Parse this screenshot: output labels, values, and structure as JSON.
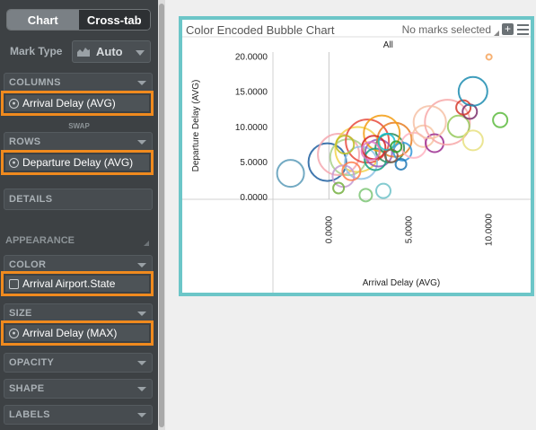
{
  "tabs": {
    "chart": "Chart",
    "crosstab": "Cross-tab"
  },
  "mark_type": {
    "label": "Mark Type",
    "value": "Auto"
  },
  "shelves": {
    "columns": {
      "label": "COLUMNS",
      "pill": "Arrival Delay (AVG)"
    },
    "swap": "SWAP",
    "rows": {
      "label": "ROWS",
      "pill": "Departure Delay (AVG)"
    },
    "details": {
      "label": "DETAILS"
    },
    "appearance": "APPEARANCE",
    "color": {
      "label": "COLOR",
      "pill": "Arrival Airport.State"
    },
    "size": {
      "label": "SIZE",
      "pill": "Arrival Delay (MAX)"
    },
    "opacity": {
      "label": "OPACITY"
    },
    "shape": {
      "label": "SHAPE"
    },
    "labels": {
      "label": "LABELS"
    }
  },
  "chart_header": {
    "title": "Color Encoded Bubble Chart",
    "status": "No marks selected"
  },
  "chart_data": {
    "type": "scatter",
    "title": "Color Encoded Bubble Chart",
    "column_header": "All",
    "xlabel": "Arrival Delay (AVG)",
    "ylabel": "Departure Delay (AVG)",
    "x_ticks": [
      "0.0000",
      "5.0000",
      "10.0000"
    ],
    "y_ticks": [
      "0.0000",
      "5.0000",
      "10.0000",
      "15.0000",
      "20.0000"
    ],
    "xlim": [
      -3.5,
      12.6
    ],
    "ylim": [
      -0.4,
      20.6
    ],
    "points": [
      {
        "x": -2.4,
        "y": 3.3,
        "size": 15,
        "color": "#5a9bb8"
      },
      {
        "x": -0.1,
        "y": 4.9,
        "size": 21,
        "color": "#1f5fa0"
      },
      {
        "x": 0.6,
        "y": 6.0,
        "size": 23,
        "color": "#f4a8b0"
      },
      {
        "x": 1.2,
        "y": 5.6,
        "size": 20,
        "color": "#a8d08a"
      },
      {
        "x": 1.8,
        "y": 6.7,
        "size": 25,
        "color": "#f2d24b"
      },
      {
        "x": 2.4,
        "y": 7.9,
        "size": 24,
        "color": "#e84a3c"
      },
      {
        "x": 2.0,
        "y": 4.8,
        "size": 18,
        "color": "#8fc3e6"
      },
      {
        "x": 3.1,
        "y": 6.2,
        "size": 15,
        "color": "#9b59b6"
      },
      {
        "x": 3.8,
        "y": 6.9,
        "size": 16,
        "color": "#2e8b57"
      },
      {
        "x": 4.1,
        "y": 8.1,
        "size": 19,
        "color": "#e67e22"
      },
      {
        "x": 3.3,
        "y": 9.0,
        "size": 20,
        "color": "#f39c12"
      },
      {
        "x": 2.9,
        "y": 5.3,
        "size": 12,
        "color": "#16a085"
      },
      {
        "x": 0.9,
        "y": 2.9,
        "size": 12,
        "color": "#c39bd3"
      },
      {
        "x": 0.6,
        "y": 1.2,
        "size": 6,
        "color": "#76b041"
      },
      {
        "x": 2.3,
        "y": 0.2,
        "size": 7,
        "color": "#7cc576"
      },
      {
        "x": 3.4,
        "y": 0.8,
        "size": 8,
        "color": "#6fc2c8"
      },
      {
        "x": 1.4,
        "y": 3.6,
        "size": 10,
        "color": "#ff7f50"
      },
      {
        "x": 4.6,
        "y": 6.4,
        "size": 10,
        "color": "#3498db"
      },
      {
        "x": 5.3,
        "y": 7.3,
        "size": 14,
        "color": "#ffb3c1"
      },
      {
        "x": 5.9,
        "y": 8.6,
        "size": 12,
        "color": "#f7c6a3"
      },
      {
        "x": 6.6,
        "y": 7.6,
        "size": 10,
        "color": "#9b2c8f"
      },
      {
        "x": 7.4,
        "y": 10.6,
        "size": 25,
        "color": "#f7a8a8"
      },
      {
        "x": 6.3,
        "y": 10.6,
        "size": 18,
        "color": "#f6c1a6"
      },
      {
        "x": 8.1,
        "y": 10.0,
        "size": 12,
        "color": "#95c95a"
      },
      {
        "x": 9.0,
        "y": 8.0,
        "size": 11,
        "color": "#e8e080"
      },
      {
        "x": 8.8,
        "y": 12.1,
        "size": 8,
        "color": "#7a2e6b"
      },
      {
        "x": 8.4,
        "y": 12.7,
        "size": 8,
        "color": "#d43a2a"
      },
      {
        "x": 9.0,
        "y": 15.0,
        "size": 16,
        "color": "#1c8cb0"
      },
      {
        "x": 10.7,
        "y": 10.9,
        "size": 8,
        "color": "#5dbb3e"
      },
      {
        "x": 10.0,
        "y": 19.9,
        "size": 3,
        "color": "#f6a35a"
      },
      {
        "x": 4.5,
        "y": 4.6,
        "size": 6,
        "color": "#1f77b4"
      },
      {
        "x": 2.8,
        "y": 7.0,
        "size": 13,
        "color": "#d62728"
      },
      {
        "x": 3.6,
        "y": 7.8,
        "size": 9,
        "color": "#17becf"
      },
      {
        "x": 1.0,
        "y": 7.4,
        "size": 10,
        "color": "#bcbd22"
      },
      {
        "x": 3.9,
        "y": 5.8,
        "size": 7,
        "color": "#8c564b"
      },
      {
        "x": 2.6,
        "y": 6.5,
        "size": 10,
        "color": "#e377c2"
      },
      {
        "x": 4.2,
        "y": 7.1,
        "size": 6,
        "color": "#2ca02c"
      }
    ]
  }
}
